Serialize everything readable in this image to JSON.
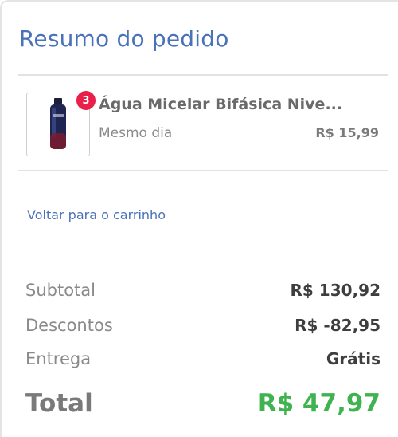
{
  "summary": {
    "title": "Resumo do pedido"
  },
  "item": {
    "quantity_badge": "3",
    "name": "Água Micelar Bifásica Nive...",
    "delivery": "Mesmo dia",
    "price": "R$ 15,99",
    "thumbnail_icon": "product-bottle-icon"
  },
  "links": {
    "back_to_cart": "Voltar para o carrinho"
  },
  "totals": {
    "subtotal_label": "Subtotal",
    "subtotal_value": "R$ 130,92",
    "discounts_label": "Descontos",
    "discounts_value": "R$ -82,95",
    "delivery_label": "Entrega",
    "delivery_value": "Grátis",
    "total_label": "Total",
    "total_value": "R$ 47,97"
  },
  "colors": {
    "title_blue": "#4a72b9",
    "badge_red": "#e8204a",
    "total_green": "#3fb34f"
  }
}
